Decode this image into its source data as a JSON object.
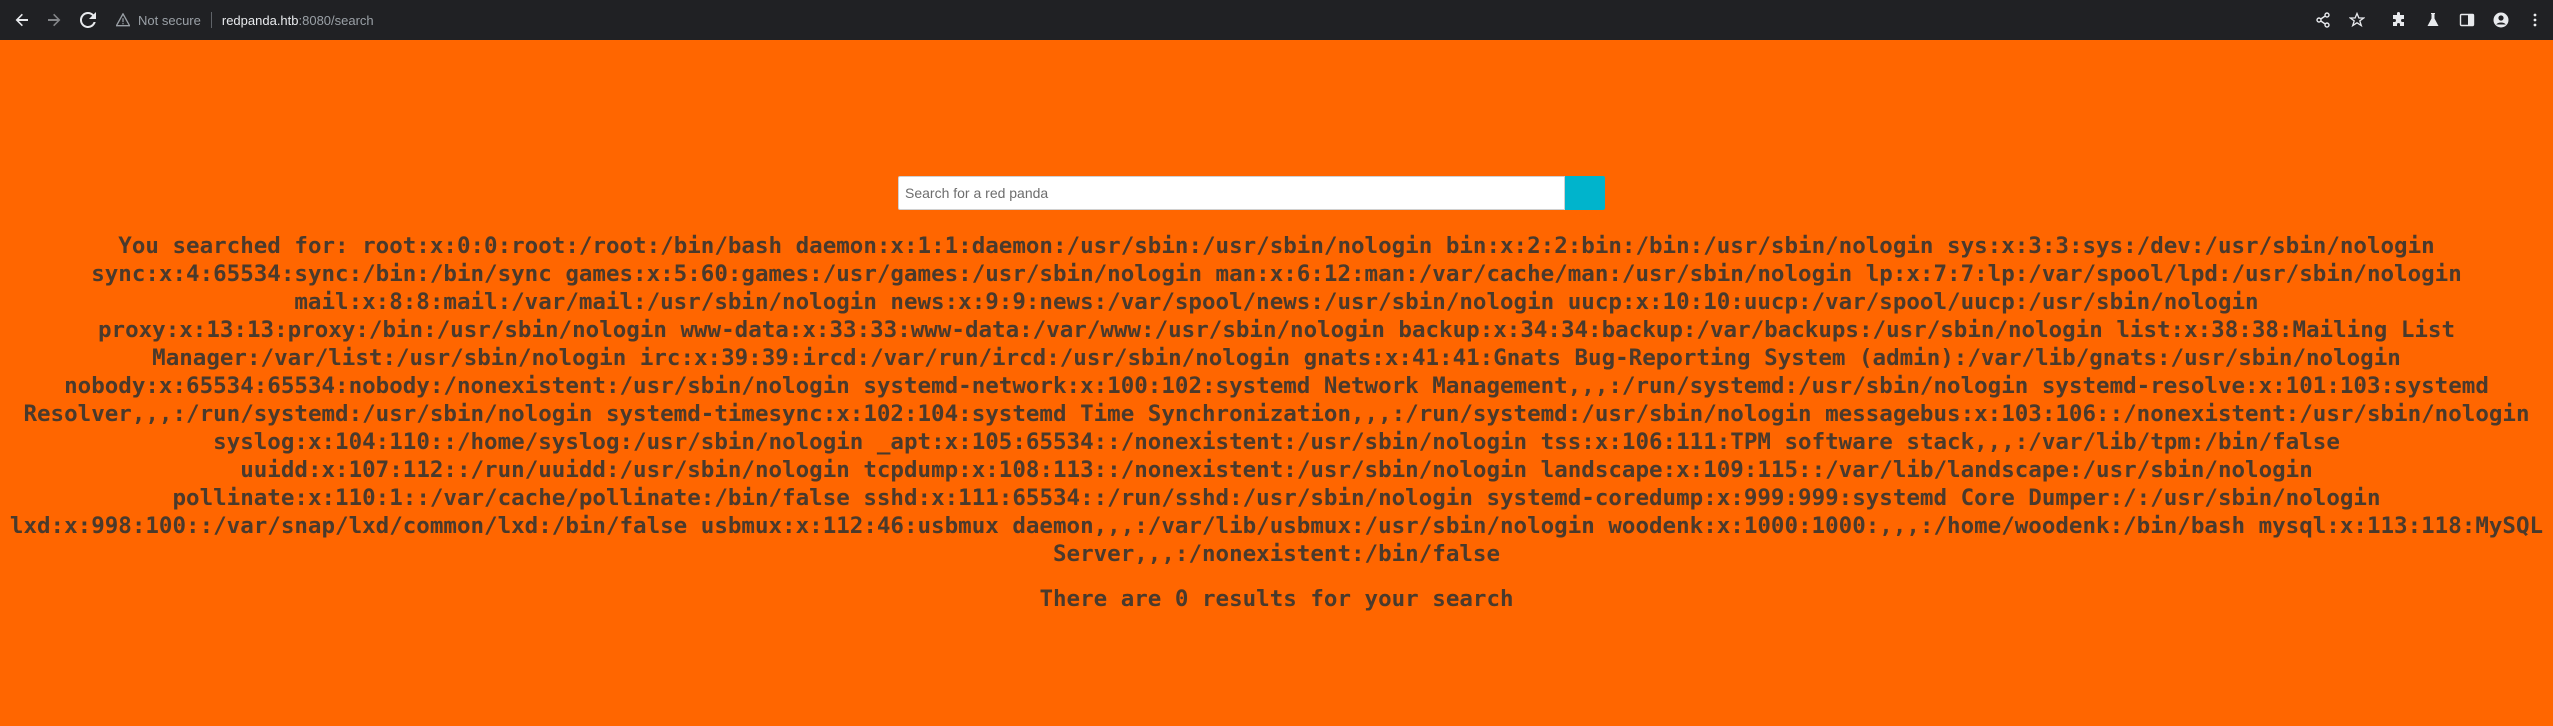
{
  "browser": {
    "security_label": "Not secure",
    "url_host": "redpanda.htb",
    "url_rest": ":8080/search",
    "icons": {
      "back": "arrow-left-icon",
      "forward": "arrow-right-icon",
      "reload": "reload-icon",
      "warning": "warning-triangle-icon",
      "share": "share-icon",
      "bookmark": "star-icon",
      "extensions": "puzzle-icon",
      "labs": "flask-icon",
      "sidepanel": "side-panel-icon",
      "profile": "avatar-icon",
      "menu": "kebab-menu-icon"
    },
    "colors": {
      "toolbar_bg": "#202124",
      "text": "#e8eaed"
    }
  },
  "search": {
    "placeholder": "Search for a red panda",
    "value": "",
    "button_color": "#00b4cc"
  },
  "results": {
    "searched_for": "You searched for: root:x:0:0:root:/root:/bin/bash daemon:x:1:1:daemon:/usr/sbin:/usr/sbin/nologin bin:x:2:2:bin:/bin:/usr/sbin/nologin sys:x:3:3:sys:/dev:/usr/sbin/nologin sync:x:4:65534:sync:/bin:/bin/sync games:x:5:60:games:/usr/games:/usr/sbin/nologin man:x:6:12:man:/var/cache/man:/usr/sbin/nologin lp:x:7:7:lp:/var/spool/lpd:/usr/sbin/nologin mail:x:8:8:mail:/var/mail:/usr/sbin/nologin news:x:9:9:news:/var/spool/news:/usr/sbin/nologin uucp:x:10:10:uucp:/var/spool/uucp:/usr/sbin/nologin proxy:x:13:13:proxy:/bin:/usr/sbin/nologin www-data:x:33:33:www-data:/var/www:/usr/sbin/nologin backup:x:34:34:backup:/var/backups:/usr/sbin/nologin list:x:38:38:Mailing List Manager:/var/list:/usr/sbin/nologin irc:x:39:39:ircd:/var/run/ircd:/usr/sbin/nologin gnats:x:41:41:Gnats Bug-Reporting System (admin):/var/lib/gnats:/usr/sbin/nologin nobody:x:65534:65534:nobody:/nonexistent:/usr/sbin/nologin systemd-network:x:100:102:systemd Network Management,,,:/run/systemd:/usr/sbin/nologin systemd-resolve:x:101:103:systemd Resolver,,,:/run/systemd:/usr/sbin/nologin systemd-timesync:x:102:104:systemd Time Synchronization,,,:/run/systemd:/usr/sbin/nologin messagebus:x:103:106::/nonexistent:/usr/sbin/nologin syslog:x:104:110::/home/syslog:/usr/sbin/nologin _apt:x:105:65534::/nonexistent:/usr/sbin/nologin tss:x:106:111:TPM software stack,,,:/var/lib/tpm:/bin/false uuidd:x:107:112::/run/uuidd:/usr/sbin/nologin tcpdump:x:108:113::/nonexistent:/usr/sbin/nologin landscape:x:109:115::/var/lib/landscape:/usr/sbin/nologin pollinate:x:110:1::/var/cache/pollinate:/bin/false sshd:x:111:65534::/run/sshd:/usr/sbin/nologin systemd-coredump:x:999:999:systemd Core Dumper:/:/usr/sbin/nologin lxd:x:998:100::/var/snap/lxd/common/lxd:/bin/false usbmux:x:112:46:usbmux daemon,,,:/var/lib/usbmux:/usr/sbin/nologin woodenk:x:1000:1000:,,,:/home/woodenk:/bin/bash mysql:x:113:118:MySQL Server,,,:/nonexistent:/bin/false",
    "count_message": "There are 0 results for your search"
  },
  "page": {
    "background": "#ff6600",
    "text_color": "#4a3a2c"
  }
}
